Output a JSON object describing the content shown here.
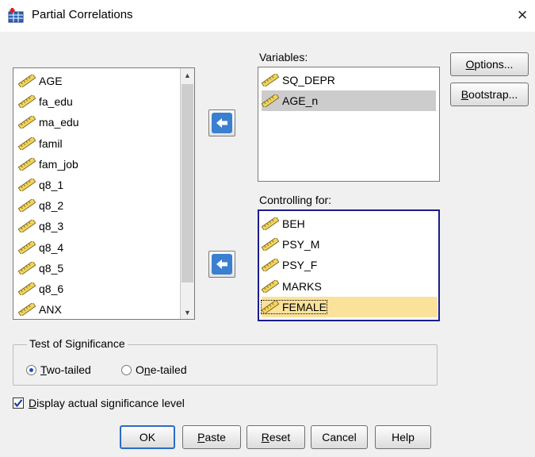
{
  "window": {
    "title": "Partial Correlations",
    "close_glyph": "×"
  },
  "source_list": {
    "items": [
      "AGE",
      "fa_edu",
      "ma_edu",
      "famil",
      "fam_job",
      "q8_1",
      "q8_2",
      "q8_3",
      "q8_4",
      "q8_5",
      "q8_6",
      "ANX"
    ],
    "item_icon": "ruler-pencil-icon"
  },
  "variables": {
    "label": "Variables:",
    "items": [
      "SQ_DEPR",
      "AGE_n"
    ],
    "selected": "AGE_n"
  },
  "controlling": {
    "label": "Controlling for:",
    "items": [
      "BEH",
      "PSY_M",
      "PSY_F",
      "MARKS",
      "FEMALE"
    ],
    "selected": "FEMALE"
  },
  "side_buttons": {
    "options": {
      "pre": "",
      "u": "O",
      "post": "ptions..."
    },
    "bootstrap": {
      "pre": "",
      "u": "B",
      "post": "ootstrap..."
    }
  },
  "significance": {
    "title": "Test of Significance",
    "two_tailed": {
      "pre": "",
      "u": "T",
      "post": "wo-tailed"
    },
    "one_tailed": {
      "pre": "O",
      "u": "n",
      "post": "e-tailed"
    },
    "selected": "two-tailed"
  },
  "display_actual": {
    "pre": "",
    "u": "D",
    "post": "isplay actual significance level",
    "checked": true
  },
  "footer_buttons": {
    "ok": "OK",
    "paste": {
      "pre": "",
      "u": "P",
      "post": "aste"
    },
    "reset": {
      "pre": "",
      "u": "R",
      "post": "eset"
    },
    "cancel": "Cancel",
    "help": "Help"
  },
  "colors": {
    "accent_blue": "#3b7fd0",
    "active_border": "#1a1c8c",
    "selection_yellow": "#fbe29b",
    "selection_gray": "#cccccc"
  }
}
